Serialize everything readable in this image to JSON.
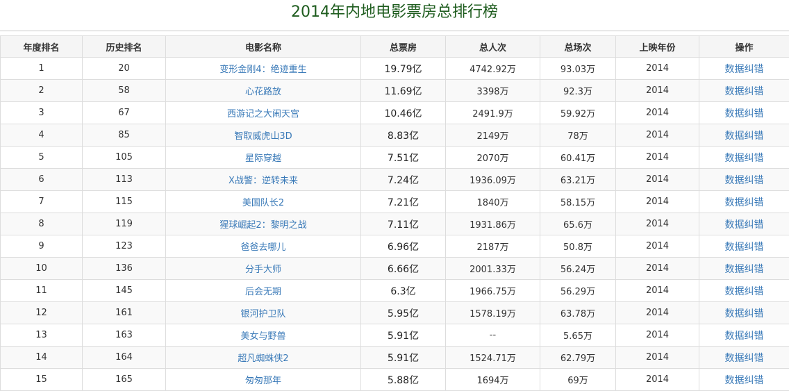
{
  "page": {
    "title": "2014年内地电影票房总排行榜"
  },
  "table": {
    "headers": {
      "year_rank": "年度排名",
      "history_rank": "历史排名",
      "movie_name": "电影名称",
      "total_gross": "总票房",
      "total_admissions": "总人次",
      "total_screenings": "总场次",
      "release_year": "上映年份",
      "action": "操作"
    },
    "rows": [
      {
        "year_rank": "1",
        "history_rank": "20",
        "movie_name": "变形金刚4：绝迹重生",
        "total_gross": "19.79亿",
        "total_admissions": "4742.92万",
        "total_screenings": "93.03万",
        "release_year": "2014",
        "action": "数据纠错"
      },
      {
        "year_rank": "2",
        "history_rank": "58",
        "movie_name": "心花路放",
        "total_gross": "11.69亿",
        "total_admissions": "3398万",
        "total_screenings": "92.3万",
        "release_year": "2014",
        "action": "数据纠错"
      },
      {
        "year_rank": "3",
        "history_rank": "67",
        "movie_name": "西游记之大闹天宫",
        "total_gross": "10.46亿",
        "total_admissions": "2491.9万",
        "total_screenings": "59.92万",
        "release_year": "2014",
        "action": "数据纠错"
      },
      {
        "year_rank": "4",
        "history_rank": "85",
        "movie_name": "智取威虎山3D",
        "total_gross": "8.83亿",
        "total_admissions": "2149万",
        "total_screenings": "78万",
        "release_year": "2014",
        "action": "数据纠错"
      },
      {
        "year_rank": "5",
        "history_rank": "105",
        "movie_name": "星际穿越",
        "total_gross": "7.51亿",
        "total_admissions": "2070万",
        "total_screenings": "60.41万",
        "release_year": "2014",
        "action": "数据纠错"
      },
      {
        "year_rank": "6",
        "history_rank": "113",
        "movie_name": "X战警：逆转未来",
        "total_gross": "7.24亿",
        "total_admissions": "1936.09万",
        "total_screenings": "63.21万",
        "release_year": "2014",
        "action": "数据纠错"
      },
      {
        "year_rank": "7",
        "history_rank": "115",
        "movie_name": "美国队长2",
        "total_gross": "7.21亿",
        "total_admissions": "1840万",
        "total_screenings": "58.15万",
        "release_year": "2014",
        "action": "数据纠错"
      },
      {
        "year_rank": "8",
        "history_rank": "119",
        "movie_name": "猩球崛起2：黎明之战",
        "total_gross": "7.11亿",
        "total_admissions": "1931.86万",
        "total_screenings": "65.6万",
        "release_year": "2014",
        "action": "数据纠错"
      },
      {
        "year_rank": "9",
        "history_rank": "123",
        "movie_name": "爸爸去哪儿",
        "total_gross": "6.96亿",
        "total_admissions": "2187万",
        "total_screenings": "50.8万",
        "release_year": "2014",
        "action": "数据纠错"
      },
      {
        "year_rank": "10",
        "history_rank": "136",
        "movie_name": "分手大师",
        "total_gross": "6.66亿",
        "total_admissions": "2001.33万",
        "total_screenings": "56.24万",
        "release_year": "2014",
        "action": "数据纠错"
      },
      {
        "year_rank": "11",
        "history_rank": "145",
        "movie_name": "后会无期",
        "total_gross": "6.3亿",
        "total_admissions": "1966.75万",
        "total_screenings": "56.29万",
        "release_year": "2014",
        "action": "数据纠错"
      },
      {
        "year_rank": "12",
        "history_rank": "161",
        "movie_name": "银河护卫队",
        "total_gross": "5.95亿",
        "total_admissions": "1578.19万",
        "total_screenings": "63.78万",
        "release_year": "2014",
        "action": "数据纠错"
      },
      {
        "year_rank": "13",
        "history_rank": "163",
        "movie_name": "美女与野兽",
        "total_gross": "5.91亿",
        "total_admissions": "--",
        "total_screenings": "5.65万",
        "release_year": "2014",
        "action": "数据纠错"
      },
      {
        "year_rank": "14",
        "history_rank": "164",
        "movie_name": "超凡蜘蛛侠2",
        "total_gross": "5.91亿",
        "total_admissions": "1524.71万",
        "total_screenings": "62.79万",
        "release_year": "2014",
        "action": "数据纠错"
      },
      {
        "year_rank": "15",
        "history_rank": "165",
        "movie_name": "匆匆那年",
        "total_gross": "5.88亿",
        "total_admissions": "1694万",
        "total_screenings": "69万",
        "release_year": "2014",
        "action": "数据纠错"
      }
    ]
  }
}
